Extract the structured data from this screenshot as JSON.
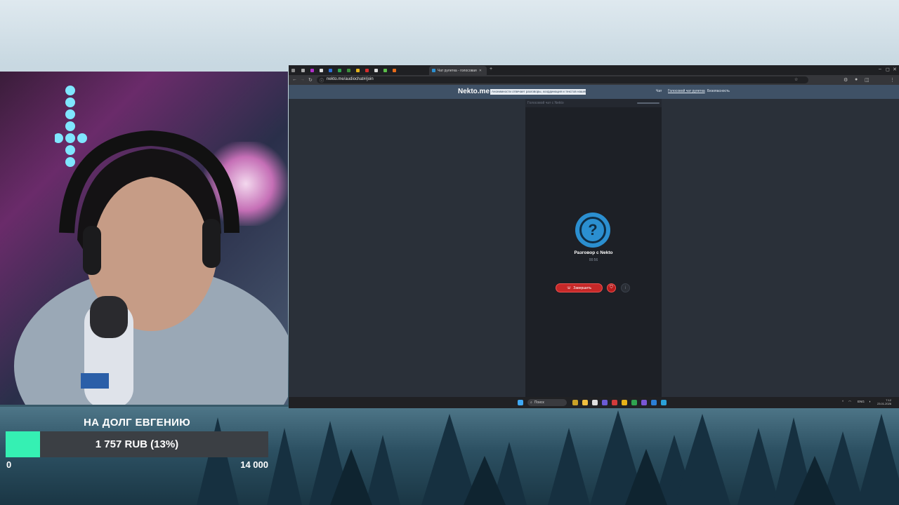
{
  "overlay": {
    "goal_title": "НА ДОЛГ ЕВГЕНИЮ",
    "progress_text": "1 757 RUB (13%)",
    "progress_fraction": 0.13,
    "min_label": "0",
    "max_label": "14 000",
    "fill_color": "#35f0b3"
  },
  "browser": {
    "active_tab_label": "Чат рулетка - голосовая",
    "url": "nekto.me/audiochat#/join",
    "window_controls": [
      "–",
      "◻",
      "✕"
    ]
  },
  "site": {
    "logo": "Nekto.me",
    "notice": "Анонимности отвечает разговоры, координация и текстов нашего сайт",
    "menu": [
      "Чат",
      "Голосовой чат рулетка",
      "Безопасность"
    ],
    "panel_label": "Голосовой чат с Nekto",
    "conversation_title": "Разговор с Nekto",
    "timer": "00:56",
    "end_button_label": "Завершить",
    "avatar_glyph": "?"
  },
  "taskbar": {
    "search_placeholder": "Поиск",
    "lang": "ENG",
    "time": "7:12",
    "date": "23.01.2026"
  },
  "icons": [
    "search-icon",
    "back-icon",
    "forward-icon",
    "reload-icon",
    "star-icon",
    "phone-icon",
    "shield-icon",
    "info-icon",
    "windows-start-icon"
  ]
}
